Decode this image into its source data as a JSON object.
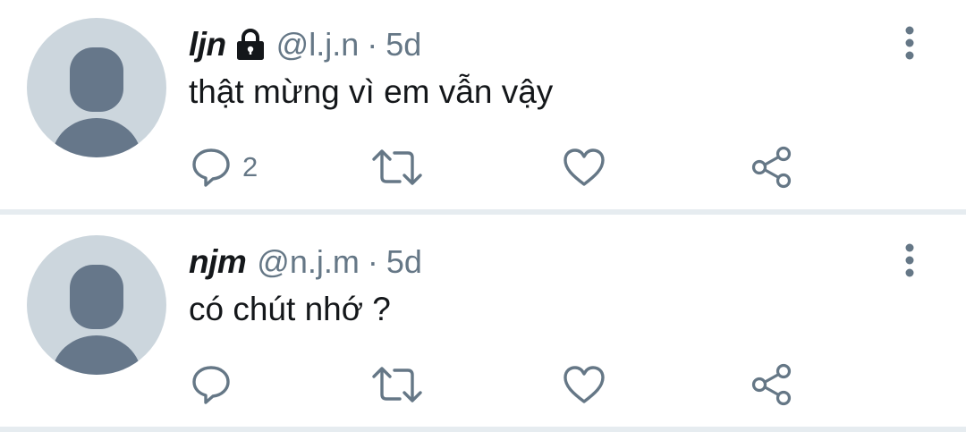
{
  "tweets": [
    {
      "display_name": "ljn",
      "locked": true,
      "handle": "@l.j.n",
      "separator": "·",
      "time": "5d",
      "text": "thật mừng vì em vẫn vậy",
      "reply_count": "2"
    },
    {
      "display_name": "njm",
      "locked": false,
      "handle": "@n.j.m",
      "separator": "·",
      "time": "5d",
      "text": "có chút nhớ ?",
      "reply_count": ""
    }
  ],
  "colors": {
    "text_primary": "#14171a",
    "text_secondary": "#657786",
    "avatar_bg": "#ccd6dd",
    "avatar_fg": "#66778a",
    "divider": "#e6ecf0"
  },
  "icons": {
    "lock": "lock-icon",
    "more": "vertical-dots-icon",
    "reply": "speech-bubble-icon",
    "retweet": "retweet-arrows-icon",
    "like": "heart-icon",
    "share": "share-nodes-icon"
  }
}
